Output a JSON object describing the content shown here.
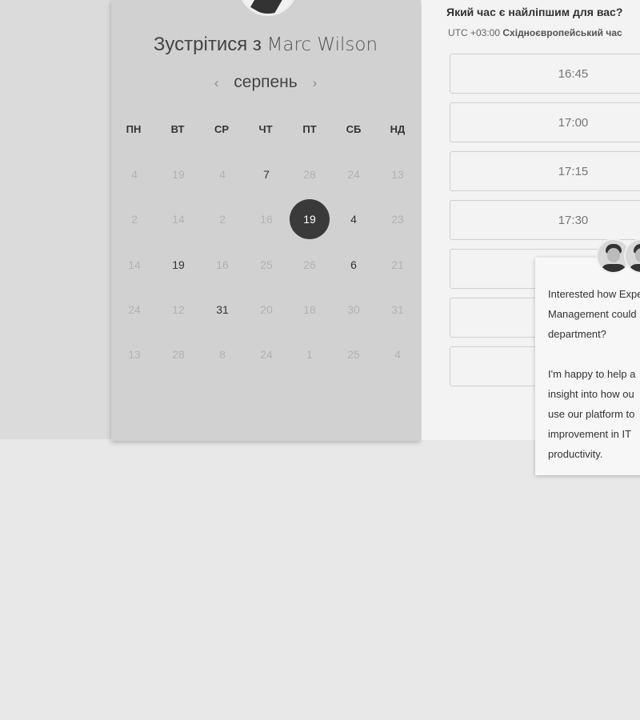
{
  "calendar": {
    "title_prefix": "Зустрітися з",
    "host_name": "Marc Wilson",
    "month": "серпень",
    "prev_icon": "‹",
    "next_icon": "›",
    "weekdays": [
      "ПН",
      "ВТ",
      "СР",
      "ЧТ",
      "ПТ",
      "СБ",
      "НД"
    ],
    "weeks": [
      [
        "4",
        "19",
        "4",
        "7",
        "28",
        "24",
        "13"
      ],
      [
        "2",
        "14",
        "2",
        "16",
        "19",
        "4",
        "23"
      ],
      [
        "14",
        "19",
        "16",
        "25",
        "26",
        "6",
        "21"
      ],
      [
        "24",
        "12",
        "31",
        "20",
        "18",
        "30",
        "31"
      ],
      [
        "13",
        "28",
        "8",
        "24",
        "1",
        "25",
        "4"
      ]
    ],
    "available_days": [
      "0-3",
      "1-5",
      "2-1",
      "2-5",
      "3-2"
    ],
    "selected_day": "19"
  },
  "time_picker": {
    "question": "Який час є найліпшим для вас?",
    "timezone_offset": "UTC +03:00",
    "timezone_name": "Східноєвропейський час",
    "slots": [
      "16:45",
      "17:00",
      "17:15",
      "17:30",
      "",
      "",
      ""
    ]
  },
  "chat_popup": {
    "message": "Interested how Experience\nManagement could\ndepartment?\n\nI'm happy to help a\ninsight into how ou\nuse our platform to\nimprovement in IT\nproductivity."
  }
}
